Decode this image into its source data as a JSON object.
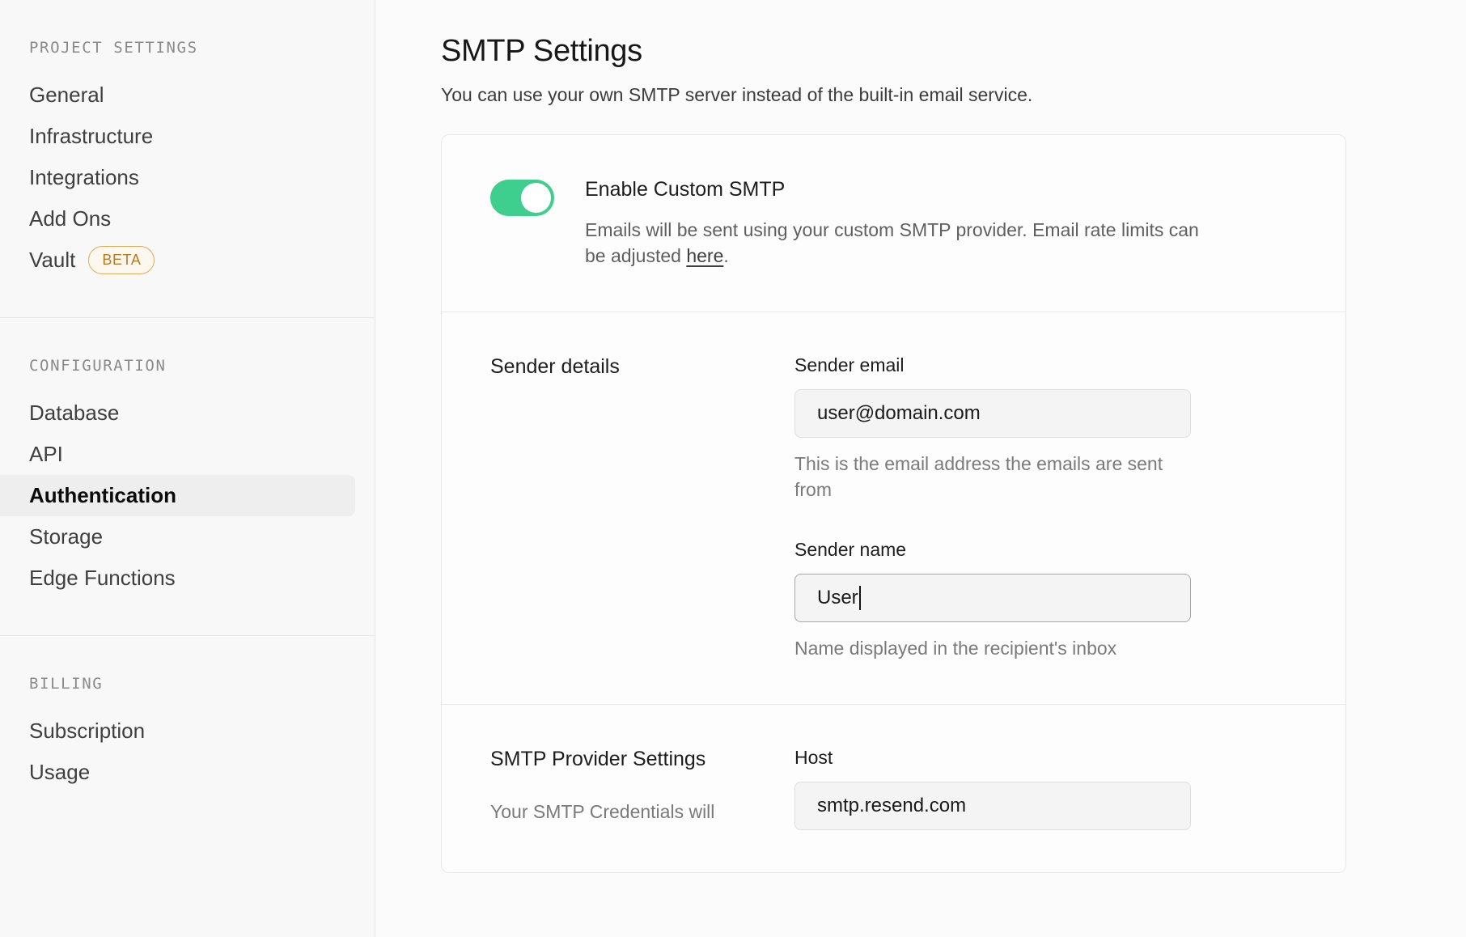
{
  "sidebar": {
    "groups": [
      {
        "title": "PROJECT SETTINGS",
        "items": [
          {
            "label": "General",
            "active": false,
            "badge": null
          },
          {
            "label": "Infrastructure",
            "active": false,
            "badge": null
          },
          {
            "label": "Integrations",
            "active": false,
            "badge": null
          },
          {
            "label": "Add Ons",
            "active": false,
            "badge": null
          },
          {
            "label": "Vault",
            "active": false,
            "badge": "BETA"
          }
        ]
      },
      {
        "title": "CONFIGURATION",
        "items": [
          {
            "label": "Database",
            "active": false,
            "badge": null
          },
          {
            "label": "API",
            "active": false,
            "badge": null
          },
          {
            "label": "Authentication",
            "active": true,
            "badge": null
          },
          {
            "label": "Storage",
            "active": false,
            "badge": null
          },
          {
            "label": "Edge Functions",
            "active": false,
            "badge": null
          }
        ]
      },
      {
        "title": "BILLING",
        "items": [
          {
            "label": "Subscription",
            "active": false,
            "badge": null
          },
          {
            "label": "Usage",
            "active": false,
            "badge": null
          }
        ]
      }
    ]
  },
  "page": {
    "title": "SMTP Settings",
    "subtitle": "You can use your own SMTP server instead of the built-in email service."
  },
  "smtp_toggle": {
    "label": "Enable Custom SMTP",
    "description_before_link": "Emails will be sent using your custom SMTP provider. Email rate limits can be adjusted ",
    "link_text": "here",
    "description_after_link": ".",
    "enabled": true,
    "on_color": "#3ecf8e"
  },
  "sender_details": {
    "heading": "Sender details",
    "sender_email": {
      "label": "Sender email",
      "value": "user@domain.com",
      "placeholder": "user@domain.com",
      "help": "This is the email address the emails are sent from",
      "focused": false
    },
    "sender_name": {
      "label": "Sender name",
      "value": "User",
      "placeholder": "Sender name",
      "help": "Name displayed in the recipient's inbox",
      "focused": true
    }
  },
  "provider_settings": {
    "heading": "SMTP Provider Settings",
    "sub": "Your SMTP Credentials will",
    "host": {
      "label": "Host",
      "value": "smtp.resend.com",
      "placeholder": "smtp.resend.com"
    }
  }
}
